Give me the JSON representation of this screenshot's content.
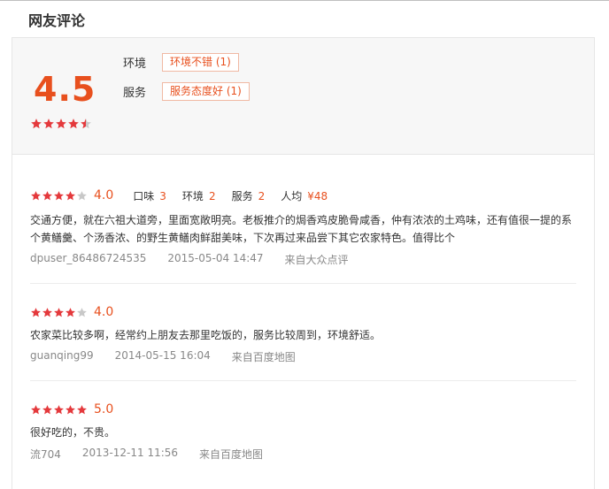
{
  "section": {
    "title": "网友评论"
  },
  "summary": {
    "score": "4.5",
    "stars": 4.5,
    "tags": [
      {
        "label": "环境",
        "tag": "环境不错 (1)"
      },
      {
        "label": "服务",
        "tag": "服务态度好 (1)"
      }
    ]
  },
  "reviews": [
    {
      "stars": 4,
      "score": "4.0",
      "subs": [
        {
          "label": "口味",
          "value": "3"
        },
        {
          "label": "环境",
          "value": "2"
        },
        {
          "label": "服务",
          "value": "2"
        },
        {
          "label": "人均",
          "value": "¥48"
        }
      ],
      "text": "交通方便，就在六祖大道旁，里面宽敞明亮。老板推介的焗香鸡皮脆骨咸香，仲有浓浓的土鸡味，还有值很一提的系个黄鳝羹、个汤香浓、的野生黄鳝肉鲜甜美味，下次再过来品尝下其它农家特色。值得比个",
      "user": "dpuser_86486724535",
      "time": "2015-05-04 14:47",
      "source": "来自大众点评"
    },
    {
      "stars": 4,
      "score": "4.0",
      "subs": [],
      "text": "农家菜比较多啊，经常约上朋友去那里吃饭的，服务比较周到，环境舒适。",
      "user": "guanqing99",
      "time": "2014-05-15 16:04",
      "source": "来自百度地图"
    },
    {
      "stars": 5,
      "score": "5.0",
      "subs": [],
      "text": "很好吃的，不贵。",
      "user": "流704",
      "time": "2013-12-11 11:56",
      "source": "来自百度地图"
    }
  ],
  "colors": {
    "accent": "#e8501e",
    "star": "#e4393c",
    "star_empty": "#c8c8c8"
  }
}
